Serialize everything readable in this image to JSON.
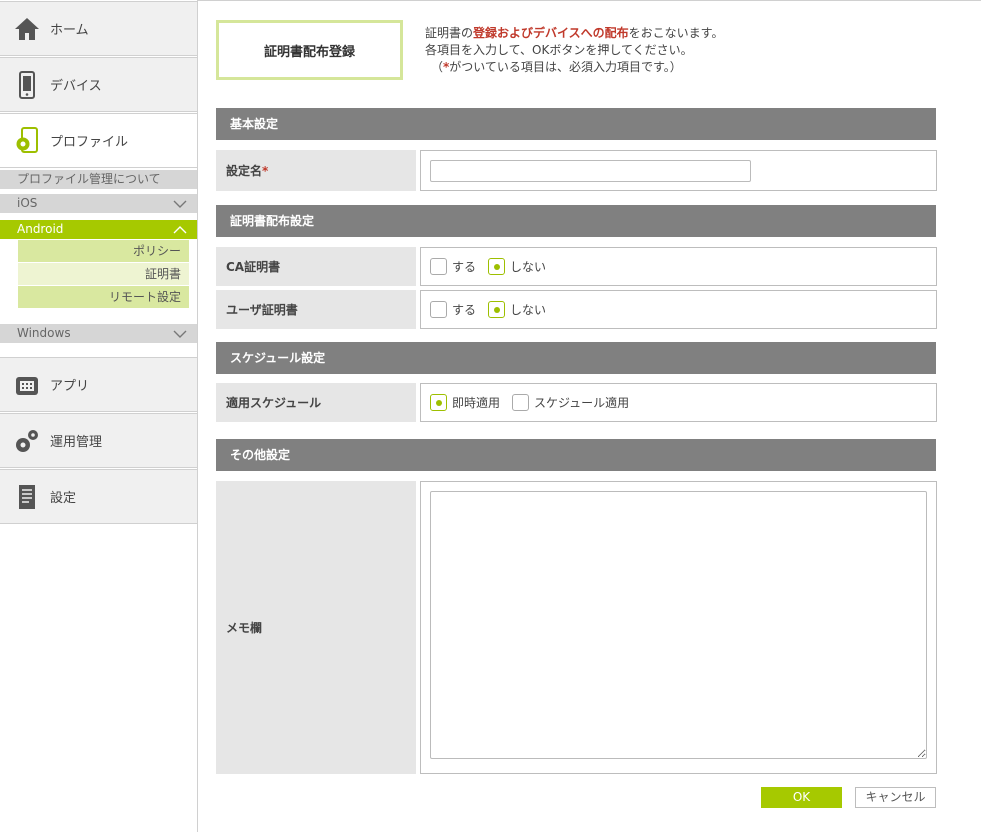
{
  "sidebar": {
    "home": {
      "label": "ホーム",
      "icon": "home-icon"
    },
    "device": {
      "label": "デバイス",
      "icon": "smartphone-icon"
    },
    "profile": {
      "label": "プロファイル",
      "icon": "profile-gear-icon"
    },
    "profile_sub": {
      "about": "プロファイル管理について",
      "ios": "iOS",
      "android": "Android",
      "android_items": [
        "ポリシー",
        "証明書",
        "リモート設定"
      ],
      "windows": "Windows"
    },
    "apps": {
      "label": "アプリ",
      "icon": "apps-icon"
    },
    "operations": {
      "label": "運用管理",
      "icon": "gears-icon"
    },
    "settings": {
      "label": "設定",
      "icon": "document-icon"
    }
  },
  "page": {
    "title": "証明書配布登録",
    "intro_pre": "証明書の",
    "intro_highlight": "登録およびデバイスへの配布",
    "intro_post": "をおこないます。",
    "intro_line2": "各項目を入力して、OKボタンを押してください。",
    "intro_line3_pre": "（",
    "intro_line3_star": "*",
    "intro_line3_post": "がついている項目は、必須入力項目です。）"
  },
  "form": {
    "basic_section": "基本設定",
    "setting_name_label": "設定名",
    "required_mark": "*",
    "setting_name_value": "",
    "cert_section": "証明書配布設定",
    "ca_cert_label": "CA証明書",
    "user_cert_label": "ユーザ証明書",
    "opt_yes": "する",
    "opt_no": "しない",
    "ca_cert_selected": "しない",
    "user_cert_selected": "しない",
    "schedule_section": "スケジュール設定",
    "apply_schedule_label": "適用スケジュール",
    "opt_immediate": "即時適用",
    "opt_scheduled": "スケジュール適用",
    "schedule_selected": "即時適用",
    "other_section": "その他設定",
    "memo_label": "メモ欄",
    "memo_value": ""
  },
  "buttons": {
    "ok": "OK",
    "cancel": "キャンセル"
  },
  "colors": {
    "accent": "#a6c900",
    "section_bar": "#808080",
    "required": "#c0392b"
  }
}
